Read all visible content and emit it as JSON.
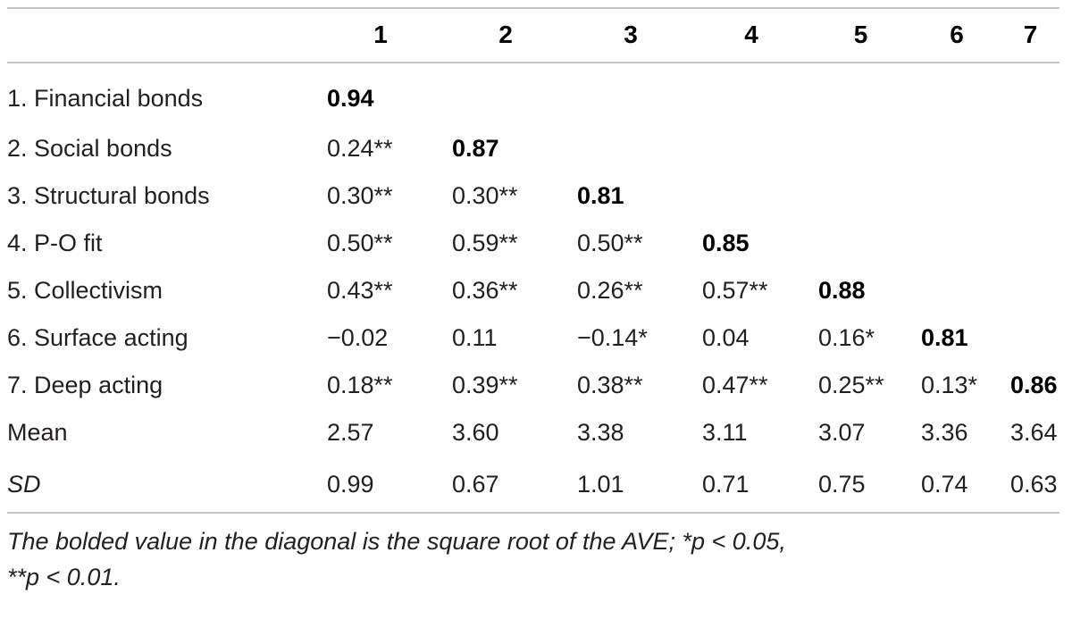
{
  "table": {
    "column_headers": [
      "",
      "1",
      "2",
      "3",
      "4",
      "5",
      "6",
      "7"
    ],
    "rows": [
      {
        "label": "1. Financial bonds",
        "values": [
          "0.94",
          "",
          "",
          "",
          "",
          "",
          ""
        ],
        "diag_index": 0,
        "label_style": "normal"
      },
      {
        "label": "2. Social bonds",
        "values": [
          "0.24**",
          "0.87",
          "",
          "",
          "",
          "",
          ""
        ],
        "diag_index": 1,
        "label_style": "normal"
      },
      {
        "label": "3. Structural bonds",
        "values": [
          "0.30**",
          "0.30**",
          "0.81",
          "",
          "",
          "",
          ""
        ],
        "diag_index": 2,
        "label_style": "normal"
      },
      {
        "label": "4. P-O fit",
        "values": [
          "0.50**",
          "0.59**",
          "0.50**",
          "0.85",
          "",
          "",
          ""
        ],
        "diag_index": 3,
        "label_style": "normal"
      },
      {
        "label": "5. Collectivism",
        "values": [
          "0.43**",
          "0.36**",
          "0.26**",
          "0.57**",
          "0.88",
          "",
          ""
        ],
        "diag_index": 4,
        "label_style": "normal"
      },
      {
        "label": "6. Surface acting",
        "values": [
          "−0.02",
          "0.11",
          "−0.14*",
          "0.04",
          "0.16*",
          "0.81",
          ""
        ],
        "diag_index": 5,
        "label_style": "normal"
      },
      {
        "label": "7. Deep acting",
        "values": [
          "0.18**",
          "0.39**",
          "0.38**",
          "0.47**",
          "0.25**",
          "0.13*",
          "0.86"
        ],
        "diag_index": 6,
        "label_style": "normal"
      },
      {
        "label": "Mean",
        "values": [
          "2.57",
          "3.60",
          "3.38",
          "3.11",
          "3.07",
          "3.36",
          "3.64"
        ],
        "diag_index": -1,
        "label_style": "normal"
      },
      {
        "label": "SD",
        "values": [
          "0.99",
          "0.67",
          "1.01",
          "0.71",
          "0.75",
          "0.74",
          "0.63"
        ],
        "diag_index": -1,
        "label_style": "italic"
      }
    ]
  },
  "footnote": {
    "line1": "The bolded value in the diagonal is the square root of the AVE; *p < 0.05,",
    "line2": "**p < 0.01."
  },
  "colors": {
    "text": "#231f20",
    "rule": "#c6c6c6",
    "bold_text": "#000000",
    "background": "#ffffff"
  }
}
